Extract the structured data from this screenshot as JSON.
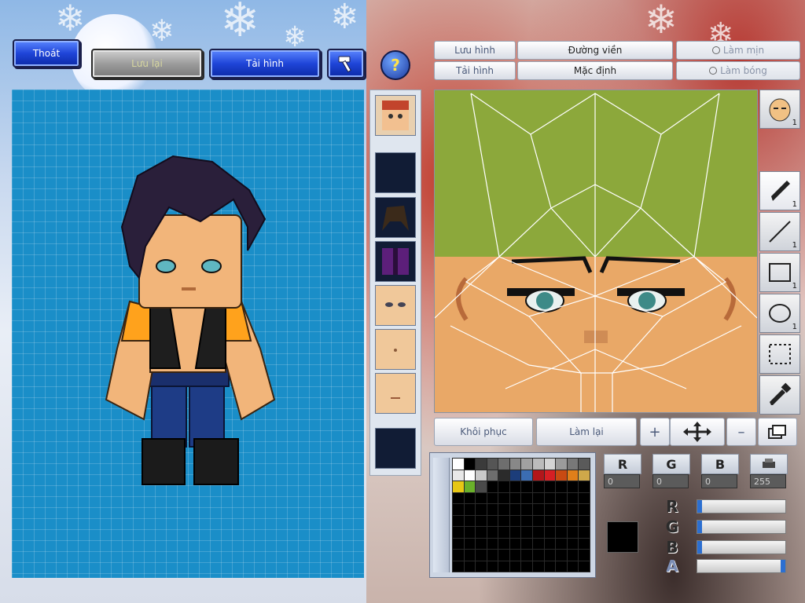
{
  "top_bar": {
    "exit_label": "Thoát",
    "save_label": "Lưu lại",
    "reload_label": "Tải hình",
    "hammer_icon": "hammer-icon",
    "help_icon": "help-icon"
  },
  "texture_tools": {
    "save_texture_label": "Lưu hình",
    "load_texture_label": "Tải hình",
    "outline_label": "Đường viền",
    "default_label": "Mặc định",
    "smooth_label": "Làm mịn",
    "shade_label": "Làm bóng"
  },
  "parts": [
    {
      "name": "head-part"
    },
    {
      "name": "empty-part-1"
    },
    {
      "name": "hair-part"
    },
    {
      "name": "jacket-part"
    },
    {
      "name": "face-part"
    },
    {
      "name": "body-part"
    },
    {
      "name": "lower-face-part"
    },
    {
      "name": "empty-part-2"
    }
  ],
  "right_tools": [
    {
      "icon": "face-preview-icon",
      "count": "1"
    },
    {
      "icon": "pen-icon",
      "count": "1"
    },
    {
      "icon": "line-icon",
      "count": "1"
    },
    {
      "icon": "rectangle-icon",
      "count": "1"
    },
    {
      "icon": "ellipse-icon",
      "count": "1"
    },
    {
      "icon": "select-icon",
      "count": ""
    },
    {
      "icon": "eyedropper-icon",
      "count": ""
    }
  ],
  "edit_bar": {
    "restore_label": "Khôi phục",
    "redo_label": "Làm lại",
    "plus_label": "+",
    "move_icon": "move-arrows-icon",
    "minus_label": "–",
    "layers_icon": "layers-icon"
  },
  "color": {
    "r_label": "R",
    "g_label": "G",
    "b_label": "B",
    "a_label": "A",
    "r_value": "0",
    "g_value": "0",
    "b_value": "0",
    "a_value": "255",
    "current_color": "#000000",
    "sliders": {
      "r": 0,
      "g": 0,
      "b": 0,
      "a": 255
    }
  },
  "palette_colors": [
    "#ffffff",
    "#000000",
    "#3b3b3b",
    "#555555",
    "#6e6e6e",
    "#888888",
    "#a1a1a1",
    "#bbbbbb",
    "#d4d4d4",
    "#9b9b9b",
    "#787878",
    "#5a5a5a",
    "#e8e8e8",
    "#ffffff",
    "#c9c9c9",
    "#6e6e6e",
    "#2b2b2b",
    "#1c3d7a",
    "#3b6db3",
    "#b2161b",
    "#d61f24",
    "#c84a12",
    "#e07f1a",
    "#cfa84a",
    "#e7c714",
    "#6ab12a",
    "#4a4a4a"
  ],
  "colors": {
    "accent_blue": "#1f45d8",
    "canvas_blue": "#1a8ec8",
    "scalp_green": "#8ca83b",
    "skin": "#e9a867"
  }
}
